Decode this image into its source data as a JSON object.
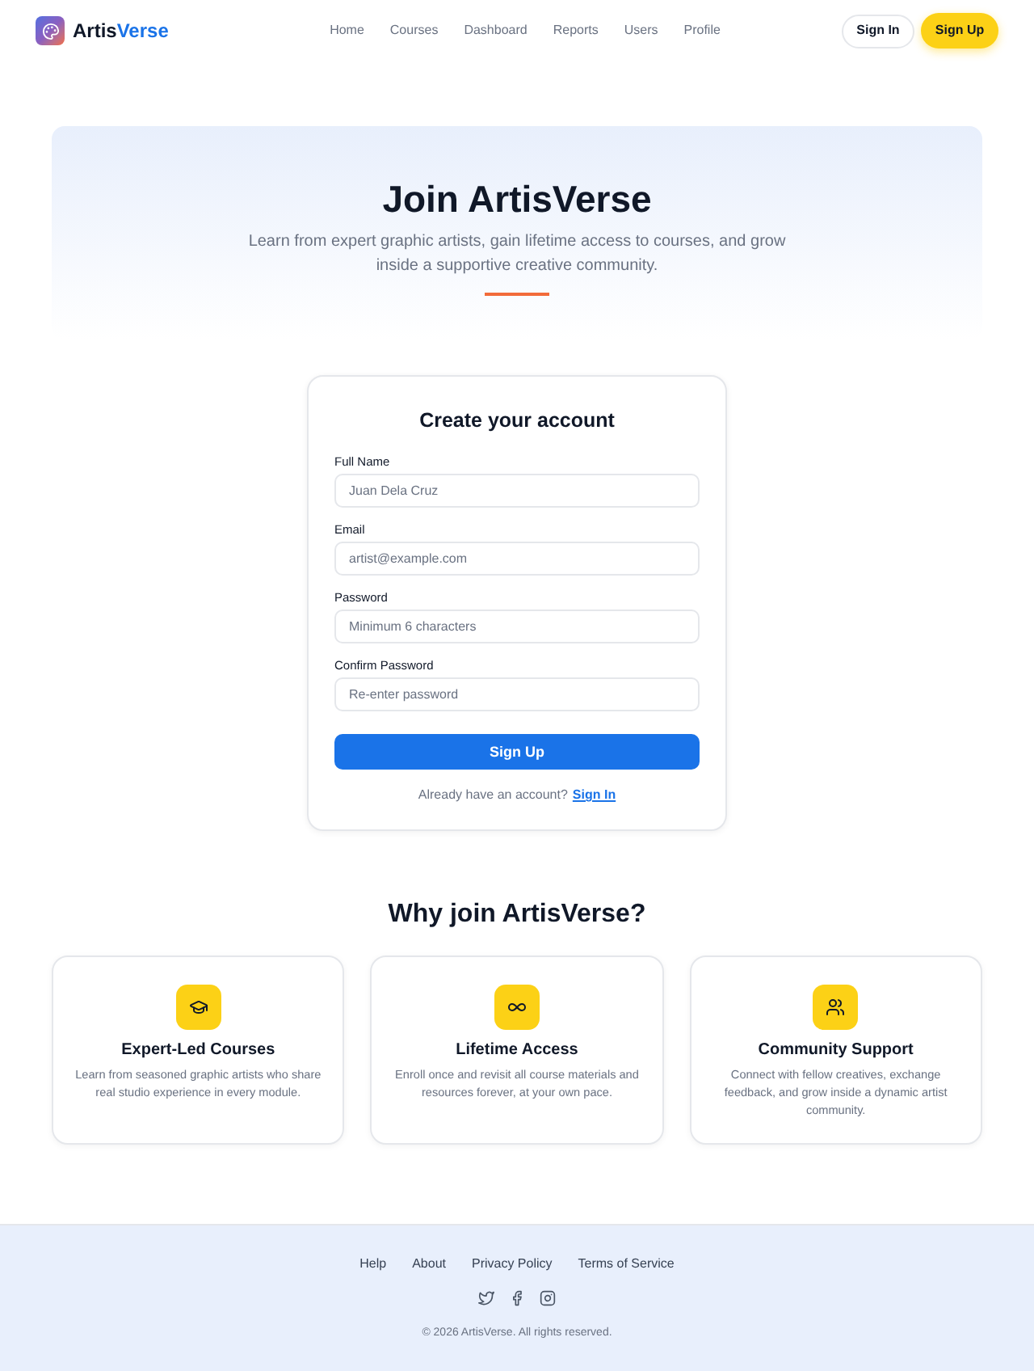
{
  "header": {
    "brand": {
      "prefix": "Artis",
      "accent": "Verse"
    },
    "nav": [
      "Home",
      "Courses",
      "Dashboard",
      "Reports",
      "Users",
      "Profile"
    ],
    "actions": [
      {
        "label": "Sign In",
        "kind": "outline"
      },
      {
        "label": "Sign Up",
        "kind": "primary"
      }
    ]
  },
  "hero": {
    "title": "Join ArtisVerse",
    "subtitle": "Learn from expert graphic artists, gain lifetime access to courses, and grow inside a supportive creative community."
  },
  "signup_form": {
    "title": "Create your account",
    "fields": [
      {
        "label": "Full Name",
        "placeholder": "Juan Dela Cruz"
      },
      {
        "label": "Email",
        "placeholder": "artist@example.com"
      },
      {
        "label": "Password",
        "placeholder": "Minimum 6 characters"
      },
      {
        "label": "Confirm Password",
        "placeholder": "Re-enter password"
      }
    ],
    "submit": "Sign Up",
    "signin_prompt": "Already have an account?",
    "signin_link": "Sign In"
  },
  "features": {
    "title": "Why join ArtisVerse?",
    "items": [
      {
        "title": "Expert-Led Courses",
        "description": "Learn from seasoned graphic artists who share real studio experience in every module."
      },
      {
        "title": "Lifetime Access",
        "description": "Enroll once and revisit all course materials and resources forever, at your own pace."
      },
      {
        "title": "Community Support",
        "description": "Connect with fellow creatives, exchange feedback, and grow inside a dynamic artist community."
      }
    ]
  },
  "footer": {
    "links": [
      "Help",
      "About",
      "Privacy Policy",
      "Terms of Service"
    ],
    "copyright": "© 2026 ArtisVerse. All rights reserved."
  }
}
